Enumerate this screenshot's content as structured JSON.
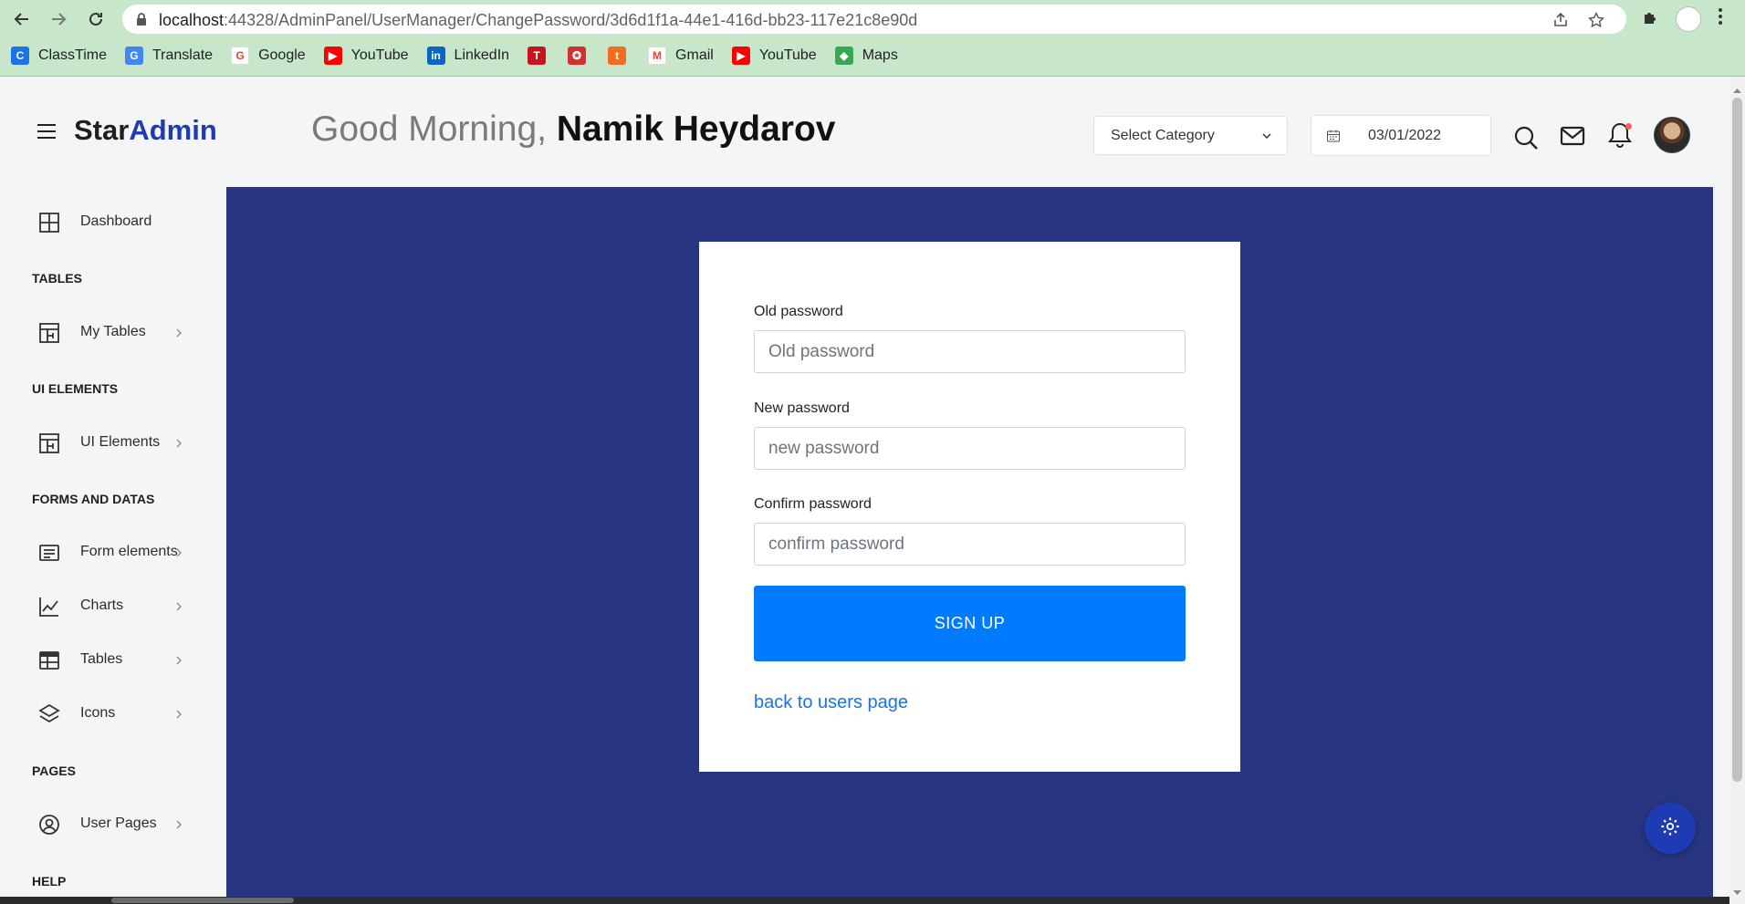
{
  "browser": {
    "url_host": "localhost",
    "url_path": ":44328/AdminPanel/UserManager/ChangePassword/3d6d1f1a-44e1-416d-bb23-117e21c8e90d",
    "bookmarks": [
      {
        "label": "ClassTime",
        "icon": "classtime-icon",
        "color": "#1a73e8",
        "glyph": "C"
      },
      {
        "label": "Translate",
        "icon": "translate-icon",
        "color": "#4285f4",
        "glyph": "G"
      },
      {
        "label": "Google",
        "icon": "google-icon",
        "color": "#ffffff",
        "glyph": "G"
      },
      {
        "label": "YouTube",
        "icon": "youtube-icon",
        "color": "#ff0000",
        "glyph": "▶"
      },
      {
        "label": "LinkedIn",
        "icon": "linkedin-icon",
        "color": "#0a66c2",
        "glyph": "in"
      },
      {
        "label": "",
        "icon": "t-red-icon",
        "color": "#c4161c",
        "glyph": "T"
      },
      {
        "label": "",
        "icon": "emblem-icon",
        "color": "#d32f2f",
        "glyph": "✪"
      },
      {
        "label": "",
        "icon": "t-orange-icon",
        "color": "#f36d21",
        "glyph": "t"
      },
      {
        "label": "Gmail",
        "icon": "gmail-icon",
        "color": "#ffffff",
        "glyph": "M"
      },
      {
        "label": "YouTube",
        "icon": "youtube-icon",
        "color": "#ff0000",
        "glyph": "▶"
      },
      {
        "label": "Maps",
        "icon": "maps-icon",
        "color": "#34a853",
        "glyph": "◆"
      }
    ]
  },
  "header": {
    "brand_main": "Star",
    "brand_accent": "Admin",
    "greeting_prefix": "Good Morning,",
    "user_name": "Namik Heydarov",
    "select_category": "Select Category",
    "date": "03/01/2022"
  },
  "sidebar": {
    "dashboard": "Dashboard",
    "sections": {
      "tables": "TABLES",
      "ui_elements": "UI ELEMENTS",
      "forms_and_datas": "FORMS AND DATAS",
      "pages": "PAGES",
      "help": "HELP"
    },
    "items": {
      "my_tables": "My Tables",
      "ui_elements": "UI Elements",
      "form_elements": "Form elements",
      "charts": "Charts",
      "tables": "Tables",
      "icons": "Icons",
      "user_pages": "User Pages"
    }
  },
  "form": {
    "old_label": "Old password",
    "old_placeholder": "Old password",
    "new_label": "New password",
    "new_placeholder": "new password",
    "confirm_label": "Confirm password",
    "confirm_placeholder": "confirm password",
    "submit_label": "SIGN UP",
    "back_link": "back to users page"
  },
  "colors": {
    "brand_accent": "#1f3bb3",
    "main_bg": "#283580",
    "primary_button": "#007bff",
    "link": "#1a73e8"
  }
}
